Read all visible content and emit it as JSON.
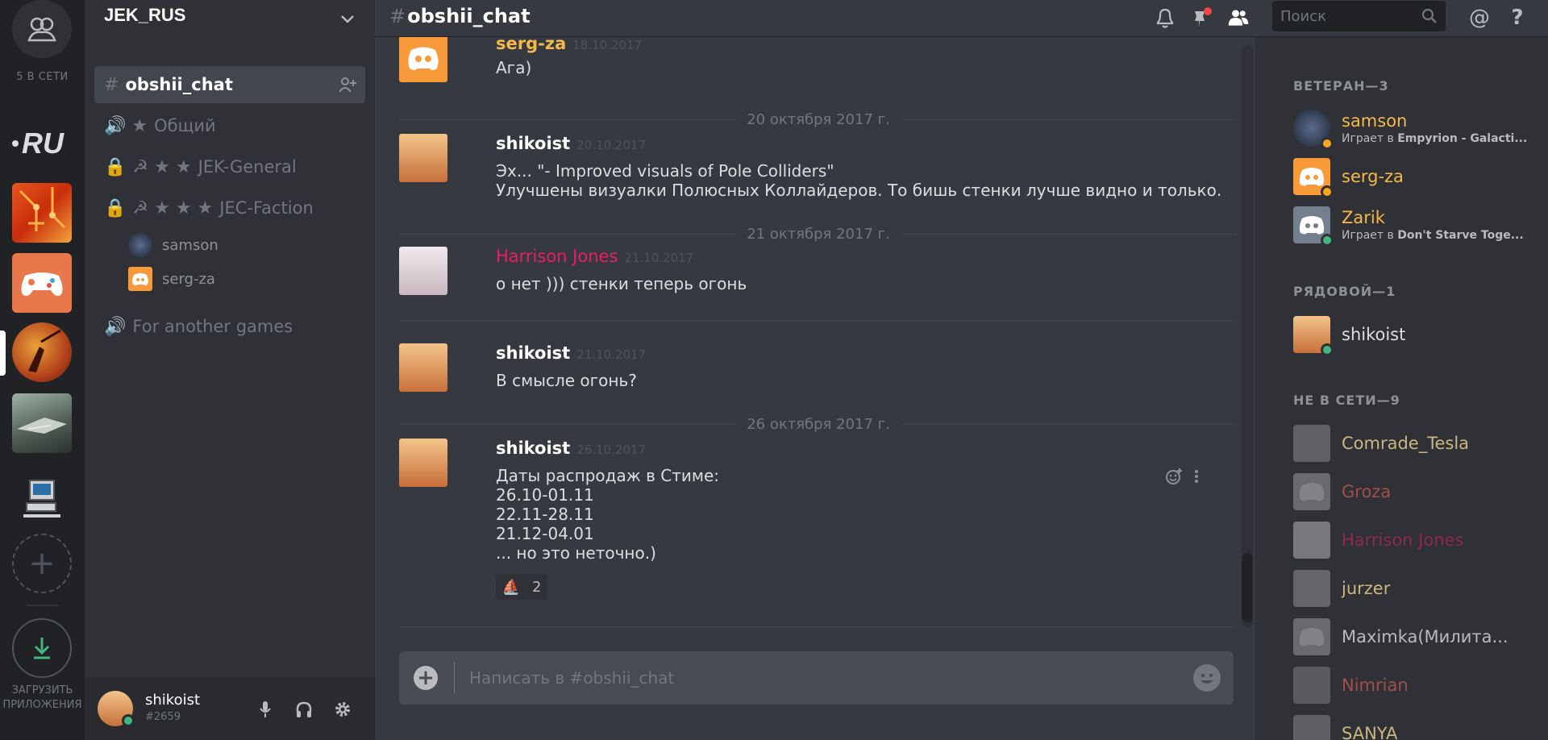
{
  "guilds": {
    "online_count": "5 В СЕТИ",
    "download_label_1": "ЗАГРУЗИТЬ",
    "download_label_2": "ПРИЛОЖЕНИЯ"
  },
  "server": {
    "name": "JEK_RUS",
    "channels": [
      {
        "prefix": "#",
        "label": "obshii_chat"
      },
      {
        "prefix": "🔊 ★",
        "label": "Общий"
      },
      {
        "prefix": "☭ ★ ★",
        "label": "JEK-General"
      },
      {
        "prefix": "☭ ★ ★ ★",
        "label": "JEC-Faction"
      },
      {
        "prefix": "🔊",
        "label": "For another games"
      }
    ],
    "voice_users": [
      "samson",
      "serg-za"
    ]
  },
  "user_panel": {
    "name": "shikoist",
    "tag": "#2659"
  },
  "header": {
    "hash": "#",
    "channel": "obshii_chat",
    "search_placeholder": "Поиск"
  },
  "messages": [
    {
      "author": "serg-za",
      "time": "18.10.2017",
      "lines": [
        "Ага)"
      ]
    },
    {
      "date": "20 октября 2017 г."
    },
    {
      "author": "shikoist",
      "time": "20.10.2017",
      "lines": [
        "Эх... \"- Improved visuals of Pole Colliders\"",
        "Улучшены визуалки Полюсных Коллайдеров. То бишь стенки лучше видно и только."
      ]
    },
    {
      "date": "21 октября 2017 г."
    },
    {
      "author": "Harrison Jones",
      "time": "21.10.2017",
      "lines": [
        "о нет ))) стенки теперь огонь"
      ]
    },
    {
      "author": "shikoist",
      "time": "21.10.2017",
      "lines": [
        "В смысле огонь?"
      ]
    },
    {
      "date": "26 октября 2017 г."
    },
    {
      "author": "shikoist",
      "time": "26.10.2017",
      "lines": [
        "Даты распродаж в Стиме:",
        "26.10-01.11",
        "22.11-28.11",
        "21.12-04.01",
        "... но это неточно.)"
      ],
      "reaction_count": "2"
    }
  ],
  "composer": {
    "placeholder": "Написать в #obshii_chat"
  },
  "members": {
    "roles": [
      {
        "label": "ВЕТЕРАН—3"
      },
      {
        "label": "РЯДОВОЙ—1"
      },
      {
        "label": "НЕ В СЕТИ—9"
      }
    ],
    "list": [
      {
        "name": "samson",
        "playing_prefix": "Играет в",
        "game": "Empyrion - Galacti..."
      },
      {
        "name": "serg-za"
      },
      {
        "name": "Zarik",
        "playing_prefix": "Играет в",
        "game": "Don't Starve Toge..."
      },
      {
        "name": "shikoist"
      },
      {
        "name": "Comrade_Tesla"
      },
      {
        "name": "Groza"
      },
      {
        "name": "Harrison Jones"
      },
      {
        "name": "jurzer"
      },
      {
        "name": "Maximka(Милита..."
      },
      {
        "name": "Nimrian"
      },
      {
        "name": "SANYA"
      }
    ]
  },
  "colors": {
    "veteran": "#f5b94a",
    "harrison": "#e91e63",
    "groza": "#e06666",
    "online": "#43b581",
    "idle": "#faa61a",
    "discord_orange": "#f8993a"
  }
}
